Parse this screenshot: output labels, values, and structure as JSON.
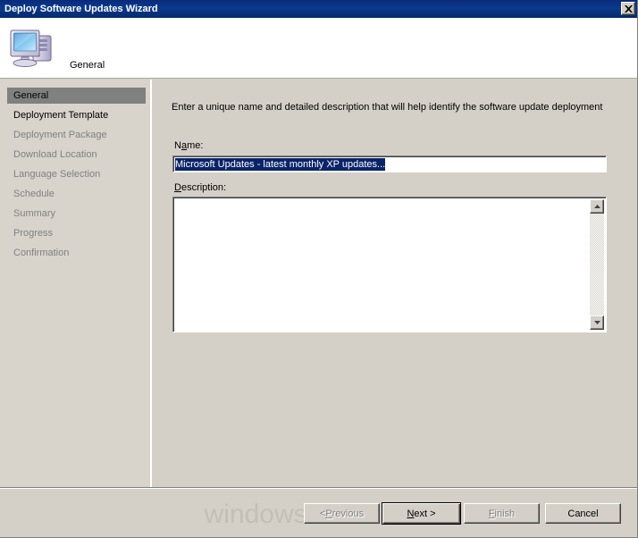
{
  "window": {
    "title": "Deploy Software Updates Wizard",
    "close_icon": "close-icon",
    "close_label": "X"
  },
  "header": {
    "icon": "computer-icon",
    "title": "General"
  },
  "sidebar": {
    "items": [
      {
        "label": "General",
        "state": "current"
      },
      {
        "label": "Deployment Template",
        "state": "next"
      },
      {
        "label": "Deployment Package",
        "state": "disabled"
      },
      {
        "label": "Download Location",
        "state": "disabled"
      },
      {
        "label": "Language Selection",
        "state": "disabled"
      },
      {
        "label": "Schedule",
        "state": "disabled"
      },
      {
        "label": "Summary",
        "state": "disabled"
      },
      {
        "label": "Progress",
        "state": "disabled"
      },
      {
        "label": "Confirmation",
        "state": "disabled"
      }
    ]
  },
  "main": {
    "intro": "Enter a unique name and detailed description that will help identify the software update deployment",
    "name_field": {
      "label_prefix": "N",
      "label_accel": "a",
      "label_suffix": "me:",
      "value": "Microsoft Updates - latest monthly XP updates...",
      "selected": true,
      "placeholder": ""
    },
    "description_field": {
      "label_accel": "D",
      "label_suffix": "escription:",
      "value": "",
      "placeholder": ""
    },
    "scrollbar": {
      "up_icon": "triangle-up-icon",
      "down_icon": "triangle-down-icon"
    }
  },
  "footer": {
    "watermark": "windows-noob.com",
    "buttons": [
      {
        "name": "previous",
        "prefix": "< ",
        "accel": "P",
        "suffix": "revious",
        "enabled": false,
        "default": false
      },
      {
        "name": "next",
        "prefix": "",
        "accel": "N",
        "suffix": "ext >",
        "enabled": true,
        "default": true
      },
      {
        "name": "finish",
        "prefix": "",
        "accel": "F",
        "suffix": "inish",
        "enabled": false,
        "default": false
      },
      {
        "name": "cancel",
        "prefix": "",
        "accel": "",
        "suffix": "Cancel",
        "enabled": true,
        "default": false
      }
    ]
  },
  "colors": {
    "titlebar": "#0a246a",
    "face": "#d4d0c8",
    "sidebar": "#d8d4cc",
    "highlight": "#808080",
    "selection": "#0a246a",
    "disabled_text": "#808080",
    "watermark": "#c3bfb6"
  }
}
